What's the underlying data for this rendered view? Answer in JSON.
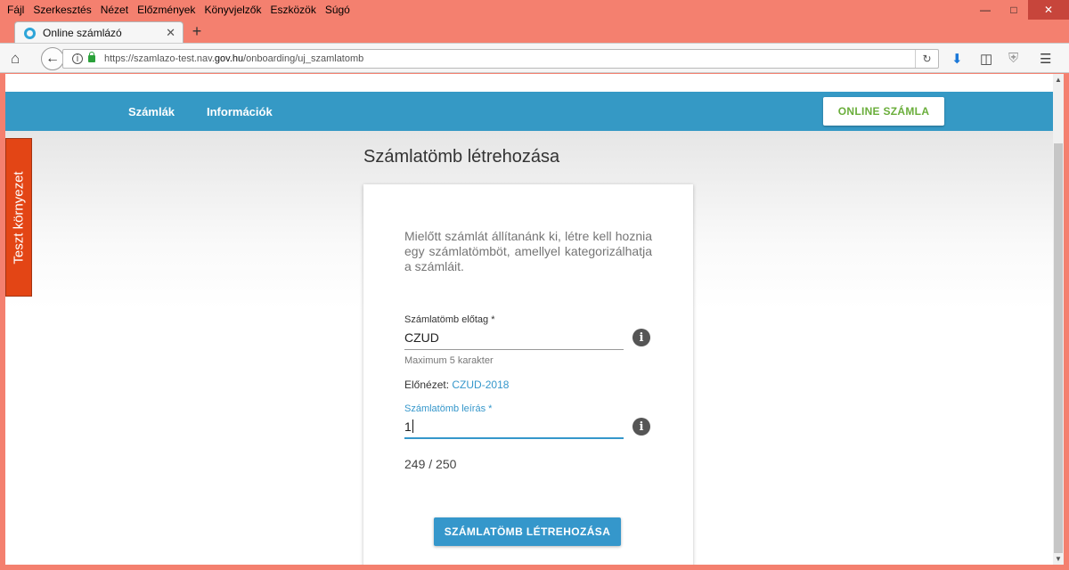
{
  "browser": {
    "menu": [
      "Fájl",
      "Szerkesztés",
      "Nézet",
      "Előzmények",
      "Könyvjelzők",
      "Eszközök",
      "Súgó"
    ],
    "tab_title": "Online számlázó",
    "url_prefix": "https://szamlazo-test.nav.",
    "url_domain": "gov.hu",
    "url_path": "/onboarding/uj_szamlatomb"
  },
  "app": {
    "nav": {
      "invoices": "Számlák",
      "info": "Információk",
      "online_button": "ONLINE SZÁMLA"
    },
    "test_env_label": "Teszt környezet",
    "accent_color": "#3599c5"
  },
  "form": {
    "title": "Számlatömb létrehozása",
    "intro": "Mielőtt számlát állítanánk ki, létre kell hoznia egy számlatömböt, amellyel kategorizálhatja a számláit.",
    "prefix_label": "Számlatömb előtag *",
    "prefix_value": "CZUD",
    "prefix_hint": "Maximum 5 karakter",
    "preview_label": "Előnézet:",
    "preview_value": "CZUD-2018",
    "desc_label": "Számlatömb leírás *",
    "desc_value": "1",
    "char_counter": "249 / 250",
    "submit_label": "SZÁMLATÖMB LÉTREHOZÁSA"
  }
}
